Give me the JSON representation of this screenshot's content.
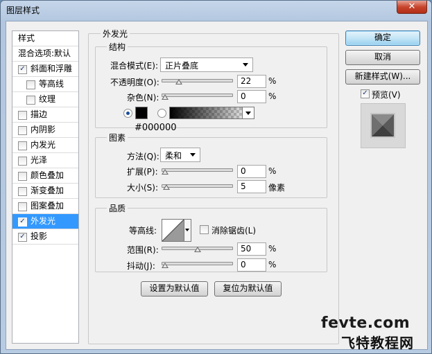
{
  "window": {
    "title": "图层样式",
    "close_glyph": "✕"
  },
  "sidebar": {
    "header": "样式",
    "blend_options": "混合选项:默认",
    "items": [
      {
        "label": "斜面和浮雕",
        "checked": true
      },
      {
        "label": "等高线",
        "checked": false
      },
      {
        "label": "纹理",
        "checked": false
      },
      {
        "label": "描边",
        "checked": false
      },
      {
        "label": "内阴影",
        "checked": false
      },
      {
        "label": "内发光",
        "checked": false
      },
      {
        "label": "光泽",
        "checked": false
      },
      {
        "label": "颜色叠加",
        "checked": false
      },
      {
        "label": "渐变叠加",
        "checked": false
      },
      {
        "label": "图案叠加",
        "checked": false
      },
      {
        "label": "外发光",
        "checked": true,
        "selected": true
      },
      {
        "label": "投影",
        "checked": true
      }
    ],
    "check_glyph": "✓"
  },
  "outer_glow": {
    "title": "外发光",
    "structure": {
      "title": "结构",
      "blend_mode_label": "混合模式(E):",
      "blend_mode_value": "正片叠底",
      "opacity_label": "不透明度(O):",
      "opacity_value": "22",
      "opacity_percent": 22,
      "noise_label": "杂色(N):",
      "noise_value": "0",
      "noise_percent": 0,
      "color_value": "#000000",
      "unit_percent": "%"
    },
    "elements": {
      "title": "图素",
      "method_label": "方法(Q):",
      "method_value": "柔和",
      "spread_label": "扩展(P):",
      "spread_value": "0",
      "spread_percent": 0,
      "size_label": "大小(S):",
      "size_value": "5",
      "size_unit": "像素",
      "unit_percent": "%"
    },
    "quality": {
      "title": "品质",
      "contour_label": "等高线:",
      "antialias_label": "消除锯齿(L)",
      "range_label": "范围(R):",
      "range_value": "50",
      "range_percent": 50,
      "jitter_label": "抖动(J):",
      "jitter_value": "0",
      "jitter_percent": 0,
      "unit_percent": "%"
    },
    "make_default": "设置为默认值",
    "reset_default": "复位为默认值"
  },
  "actions": {
    "ok": "确定",
    "cancel": "取消",
    "new_style": "新建样式(W)...",
    "preview_label": "预览(V)",
    "preview_checked": true
  },
  "watermark": {
    "line1": "fevte.com",
    "line2": "飞特教程网"
  },
  "colors": {
    "selection": "#3399ff",
    "glow_color": "#000000"
  }
}
